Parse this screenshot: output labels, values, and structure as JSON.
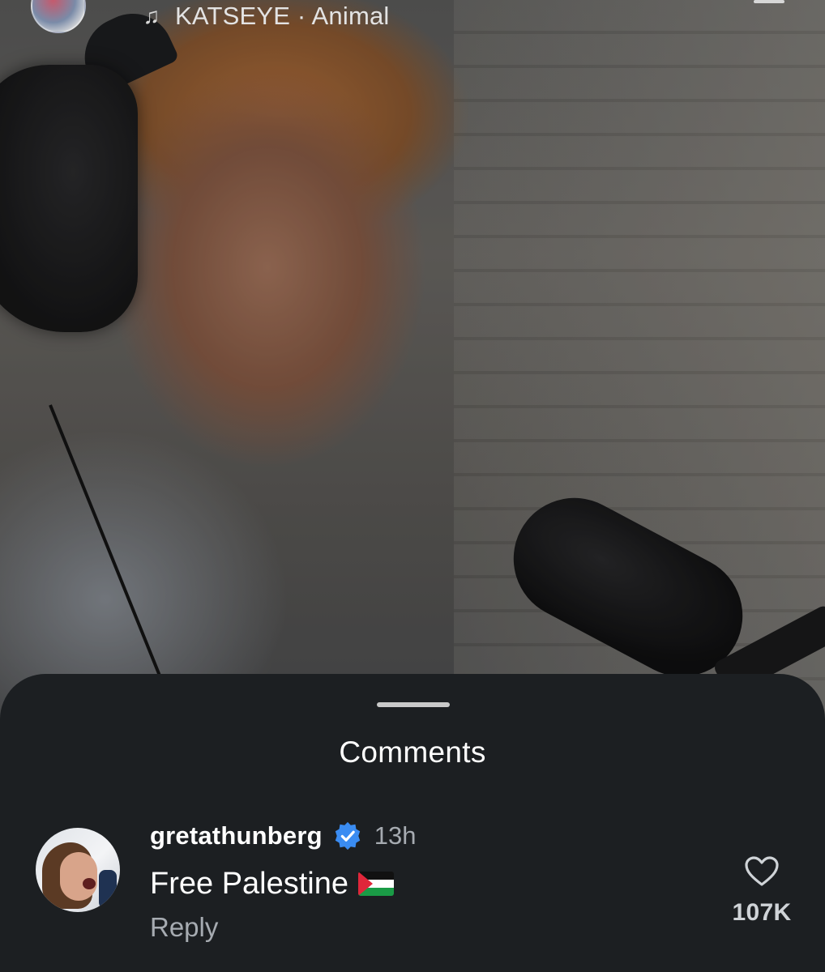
{
  "music": {
    "icon": "music-note-icon",
    "track": "KATSEYE · Animal"
  },
  "comments_sheet": {
    "title": "Comments",
    "comments": [
      {
        "username": "gretathunberg",
        "verified": true,
        "time": "13h",
        "text": "Free Palestine",
        "emoji": "palestine-flag",
        "reply_label": "Reply",
        "likes": "107K"
      }
    ]
  },
  "colors": {
    "sheet_bg": "#1c1f22",
    "verified_blue": "#3a8cf2",
    "muted_text": "#a6abb1"
  }
}
